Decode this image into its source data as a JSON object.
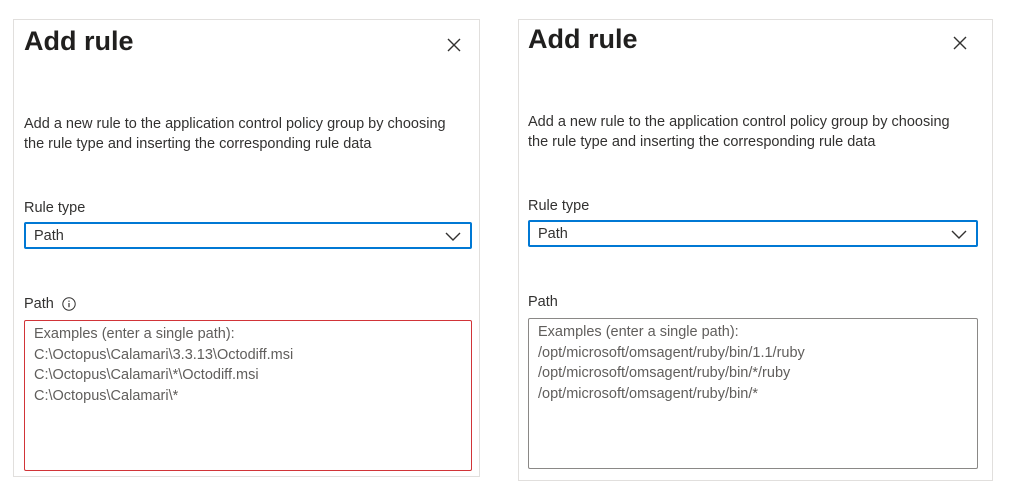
{
  "left_panel": {
    "title": "Add rule",
    "description": "Add a new rule to the application control policy group by choosing the rule type and inserting the corresponding rule data",
    "rule_type_label": "Rule type",
    "rule_type_value": "Path",
    "path_label": "Path",
    "path_placeholder_lines": [
      "Examples (enter a single path):",
      "C:\\Octopus\\Calamari\\3.3.13\\Octodiff.msi",
      "C:\\Octopus\\Calamari\\*\\Octodiff.msi",
      "C:\\Octopus\\Calamari\\*"
    ],
    "icons": {
      "close": "close-icon",
      "info": "info-icon",
      "dropdown": "chevron-down-icon"
    },
    "path_field_state": "error"
  },
  "right_panel": {
    "title": "Add rule",
    "description": "Add a new rule to the application control policy group by choosing the rule type and inserting the corresponding rule data",
    "rule_type_label": "Rule type",
    "rule_type_value": "Path",
    "path_label": "Path",
    "path_placeholder_lines": [
      "Examples (enter a single path):",
      "/opt/microsoft/omsagent/ruby/bin/1.1/ruby",
      "/opt/microsoft/omsagent/ruby/bin/*/ruby",
      "/opt/microsoft/omsagent/ruby/bin/*"
    ],
    "icons": {
      "close": "close-icon",
      "dropdown": "chevron-down-icon"
    },
    "path_field_state": "normal"
  },
  "colors": {
    "focus_border": "#0078d4",
    "error_border": "#d13438",
    "text": "#323130",
    "placeholder": "#605e5c",
    "panel_border": "#e1dfdd"
  }
}
